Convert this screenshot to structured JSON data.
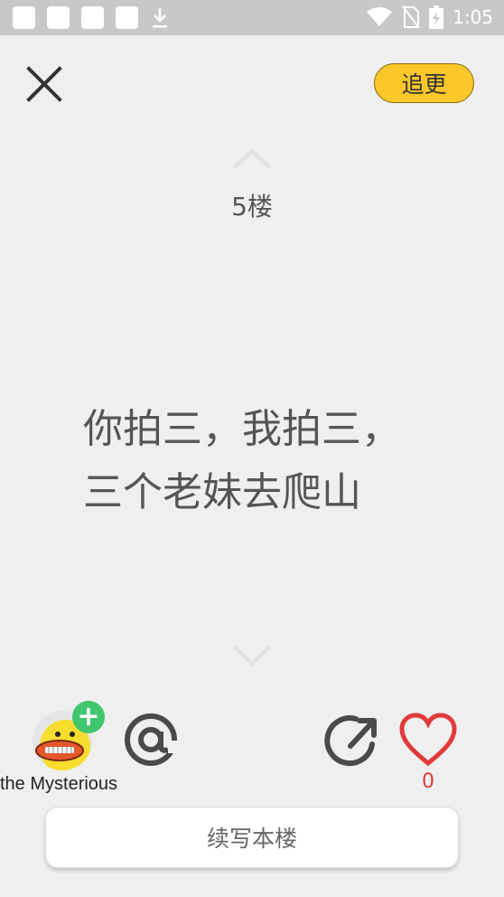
{
  "status_bar": {
    "time": "1:05",
    "icons": [
      "notification-square-icon",
      "notification-square-icon",
      "notification-square-icon",
      "notification-square-icon",
      "download-icon",
      "wifi-icon",
      "no-sim-icon",
      "battery-charging-icon"
    ]
  },
  "header": {
    "close_icon": "close-icon",
    "follow_label": "追更"
  },
  "post": {
    "floor_label": "5楼",
    "lines": [
      "你拍三，我拍三，",
      "三个老妹去爬山"
    ]
  },
  "author": {
    "name": "the Mysterious",
    "add_icon": "plus-icon"
  },
  "actions": {
    "mention_icon": "at-icon",
    "share_icon": "share-icon",
    "like_icon": "heart-icon",
    "like_count": "0"
  },
  "footer": {
    "continue_label": "续写本楼"
  },
  "colors": {
    "background": "#efefef",
    "accent_yellow": "#fcc72b",
    "like_red": "#e23a3a",
    "add_green": "#3fc66f"
  }
}
